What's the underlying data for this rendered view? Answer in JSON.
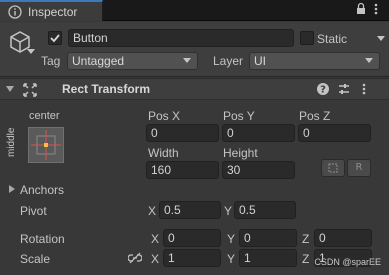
{
  "tab": {
    "label": "Inspector",
    "icons": [
      "info-icon",
      "lock-icon",
      "more-options-icon"
    ]
  },
  "object": {
    "active": true,
    "name": "Button",
    "static_label": "Static",
    "static_checked": false,
    "tag_label": "Tag",
    "tag_value": "Untagged",
    "layer_label": "Layer",
    "layer_value": "UI"
  },
  "component": {
    "title": "Rect Transform",
    "header_icons": [
      "help-icon",
      "presets-icon",
      "more-options-icon"
    ]
  },
  "rect": {
    "anchor_horizontal": "center",
    "anchor_vertical": "middle",
    "pos_x_label": "Pos X",
    "pos_y_label": "Pos Y",
    "pos_z_label": "Pos Z",
    "pos_x": "0",
    "pos_y": "0",
    "pos_z": "0",
    "width_label": "Width",
    "height_label": "Height",
    "width": "160",
    "height": "30",
    "raw_edit_label": "R"
  },
  "anchors": {
    "label": "Anchors"
  },
  "pivot": {
    "label": "Pivot",
    "x_label": "X",
    "x": "0.5",
    "y_label": "Y",
    "y": "0.5"
  },
  "rotation": {
    "label": "Rotation",
    "x_label": "X",
    "x": "0",
    "y_label": "Y",
    "y": "0",
    "z_label": "Z",
    "z": "0"
  },
  "scale": {
    "label": "Scale",
    "x_label": "X",
    "x": "1",
    "y_label": "Y",
    "y": "1",
    "z_label": "Z",
    "z": "1"
  },
  "watermark": "CSDN @sparEE",
  "colors": {
    "accent": "#3a79bb",
    "panel": "#383838",
    "field": "#2a2a2a"
  }
}
